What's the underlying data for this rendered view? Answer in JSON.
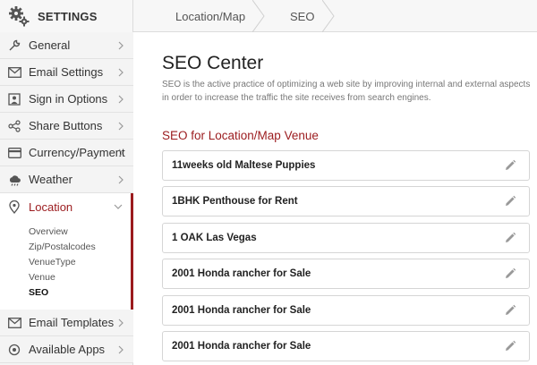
{
  "header": {
    "app_title": "SETTINGS",
    "breadcrumbs": [
      "Location/Map",
      "SEO"
    ]
  },
  "sidebar": {
    "items": [
      {
        "label": "General",
        "icon": "wrench-icon"
      },
      {
        "label": "Email Settings",
        "icon": "envelope-icon"
      },
      {
        "label": "Sign in Options",
        "icon": "user-icon"
      },
      {
        "label": "Share Buttons",
        "icon": "share-icon"
      },
      {
        "label": "Currency/Payment",
        "icon": "credit-card-icon"
      },
      {
        "label": "Weather",
        "icon": "cloud-icon"
      }
    ],
    "location": {
      "label": "Location",
      "icon": "map-pin-icon",
      "subitems": [
        "Overview",
        "Zip/Postalcodes",
        "VenueType",
        "Venue",
        "SEO"
      ],
      "active_subitem": "SEO"
    },
    "bottom_items": [
      {
        "label": "Email Templates",
        "icon": "envelope-icon"
      },
      {
        "label": "Available Apps",
        "icon": "apps-icon"
      }
    ]
  },
  "main": {
    "title": "SEO Center",
    "description": "SEO is the active practice of optimizing a web site by improving internal and external aspects in order to increase the traffic the site receives from search engines.",
    "section_title": "SEO for Location/Map Venue",
    "venues": [
      "11weeks old Maltese Puppies",
      "1BHK Penthouse for Rent",
      "1 OAK Las Vegas",
      "2001 Honda rancher for Sale",
      "2001 Honda rancher for Sale",
      "2001 Honda rancher for Sale"
    ]
  },
  "colors": {
    "accent": "#9b1b1e",
    "sidebar_bg": "#f4f4f4",
    "border": "#d5d5d5"
  }
}
